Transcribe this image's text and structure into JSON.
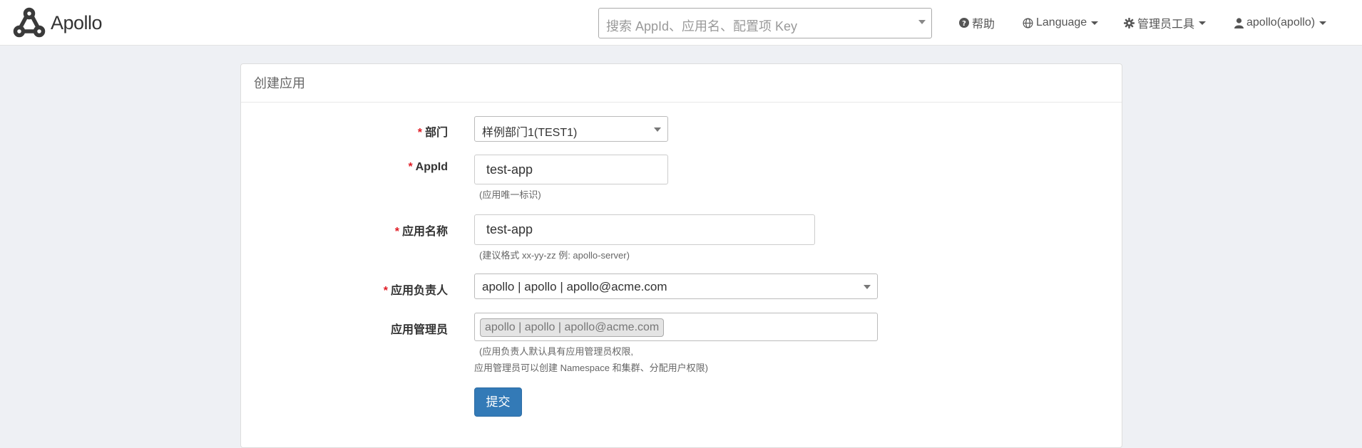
{
  "brand": {
    "name": "Apollo",
    "logo_icon": "apollo-logo-icon"
  },
  "nav": {
    "search_placeholder": "搜索 AppId、应用名、配置项 Key",
    "help": "帮助",
    "language": "Language",
    "admin_tools": "管理员工具",
    "user": "apollo(apollo)"
  },
  "panel": {
    "title": "创建应用"
  },
  "form": {
    "department": {
      "label": "部门",
      "value": "样例部门1(TEST1)"
    },
    "app_id": {
      "label": "AppId",
      "value": "test-app",
      "help": "(应用唯一标识)"
    },
    "app_name": {
      "label": "应用名称",
      "value": "test-app",
      "help": "(建议格式 xx-yy-zz 例: apollo-server)"
    },
    "owner": {
      "label": "应用负责人",
      "value": "apollo | apollo | apollo@acme.com"
    },
    "admins": {
      "label": "应用管理员",
      "tag": "apollo | apollo | apollo@acme.com",
      "help_line1": "(应用负责人默认具有应用管理员权限,",
      "help_line2": "应用管理员可以创建 Namespace 和集群、分配用户权限)"
    },
    "submit": "提交"
  },
  "colors": {
    "primary": "#337ab7",
    "required": "#e01b24",
    "background": "#eef0f4"
  }
}
